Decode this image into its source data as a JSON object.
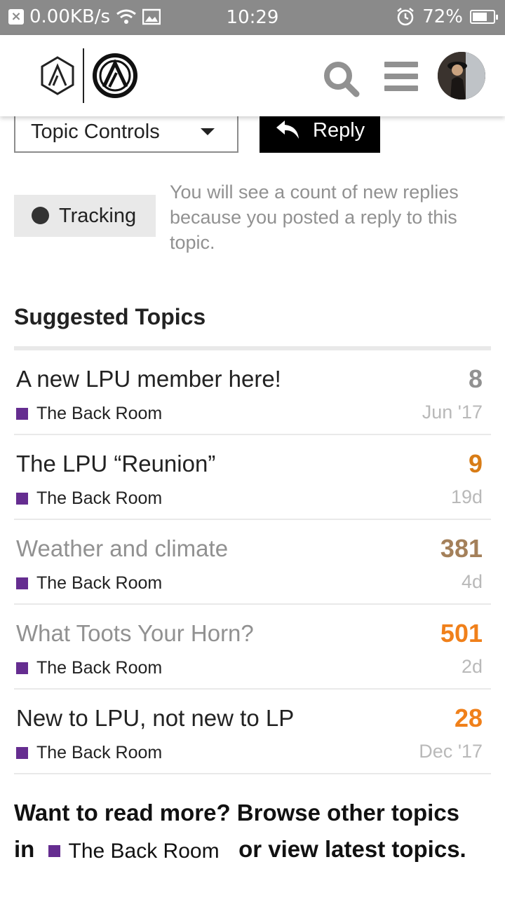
{
  "status_bar": {
    "network_speed": "0.00KB/s",
    "time": "10:29",
    "battery": "72%",
    "battery_level": 0.72
  },
  "header": {
    "logo": "Linkin Park",
    "icons": [
      "search-icon",
      "hamburger-menu-icon",
      "user-avatar"
    ]
  },
  "controls": {
    "topic_controls_label": "Topic Controls",
    "reply_label": "Reply",
    "tracking_label": "Tracking",
    "tracking_description": "You will see a count of new replies because you posted a reply to this topic."
  },
  "suggested": {
    "heading": "Suggested Topics",
    "topics": [
      {
        "title": "A new LPU member here!",
        "category": "The Back Room",
        "count": "8",
        "age": "Jun '17",
        "title_color": "#222222",
        "count_color": "#919191"
      },
      {
        "title": "The LPU “Reunion”",
        "category": "The Back Room",
        "count": "9",
        "age": "19d",
        "title_color": "#222222",
        "count_color": "#d87c16"
      },
      {
        "title": "Weather and climate",
        "category": "The Back Room",
        "count": "381",
        "age": "4d",
        "title_color": "#919191",
        "count_color": "#a4805a"
      },
      {
        "title": "What Toots Your Horn?",
        "category": "The Back Room",
        "count": "501",
        "age": "2d",
        "title_color": "#919191",
        "count_color": "#f0801a"
      },
      {
        "title": "New to LPU, not new to LP",
        "category": "The Back Room",
        "count": "28",
        "age": "Dec '17",
        "title_color": "#222222",
        "count_color": "#f0801a"
      }
    ],
    "category_color": "#652d90"
  },
  "footer": {
    "text_1": "Want to read more? Browse other topics",
    "in_label": "in",
    "category": "The Back Room",
    "text_2": "or view latest topics."
  }
}
